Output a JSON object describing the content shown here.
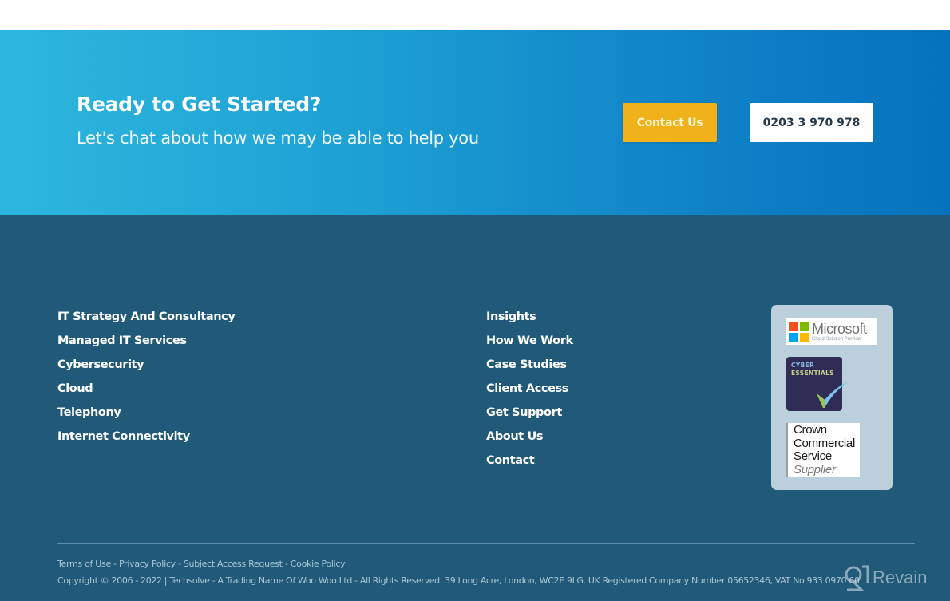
{
  "cta": {
    "title": "Ready to Get Started?",
    "subtitle": "Let's chat about how we may be able to help you",
    "contact_button": "Contact Us",
    "phone_button": "0203 3 970 978",
    "colors": {
      "contact_button_bg": "#f0b21a",
      "gradient_start": "#2db7de",
      "gradient_end": "#0672bd"
    }
  },
  "footer": {
    "services_links": [
      {
        "label": "IT Strategy And Consultancy"
      },
      {
        "label": "Managed IT Services"
      },
      {
        "label": "Cybersecurity"
      },
      {
        "label": "Cloud"
      },
      {
        "label": "Telephony"
      },
      {
        "label": "Internet Connectivity"
      }
    ],
    "company_links": [
      {
        "label": "Insights"
      },
      {
        "label": "How We Work"
      },
      {
        "label": "Case Studies"
      },
      {
        "label": "Client Access"
      },
      {
        "label": "Get Support"
      },
      {
        "label": "About Us"
      },
      {
        "label": "Contact"
      }
    ],
    "badges": {
      "microsoft": {
        "name": "Microsoft",
        "subtitle": "Cloud Solution Provider",
        "icon": "microsoft-logo-icon"
      },
      "cyber_essentials": {
        "line1": "CYBER",
        "line2": "ESSENTIALS",
        "icon": "checkmark-icon"
      },
      "crown_commercial": {
        "line1": "Crown",
        "line2": "Commercial",
        "line3": "Service",
        "line4": "Supplier"
      }
    },
    "legal_links": [
      {
        "label": "Terms of Use"
      },
      {
        "label": "Privacy Policy"
      },
      {
        "label": "Subject Access Request"
      },
      {
        "label": "Cookie Policy"
      }
    ],
    "legal_separator": " - ",
    "copyright": "Copyright © 2006 - 2022 | Techsolve - A Trading Name Of Woo Woo Ltd - All Rights Reserved. 39 Long Acre, London, WC2E 9LG. UK Registered Company Number 05652346, VAT No 933 0970 60",
    "colors": {
      "background": "#205a78"
    }
  },
  "watermark": {
    "label": "Revain"
  }
}
